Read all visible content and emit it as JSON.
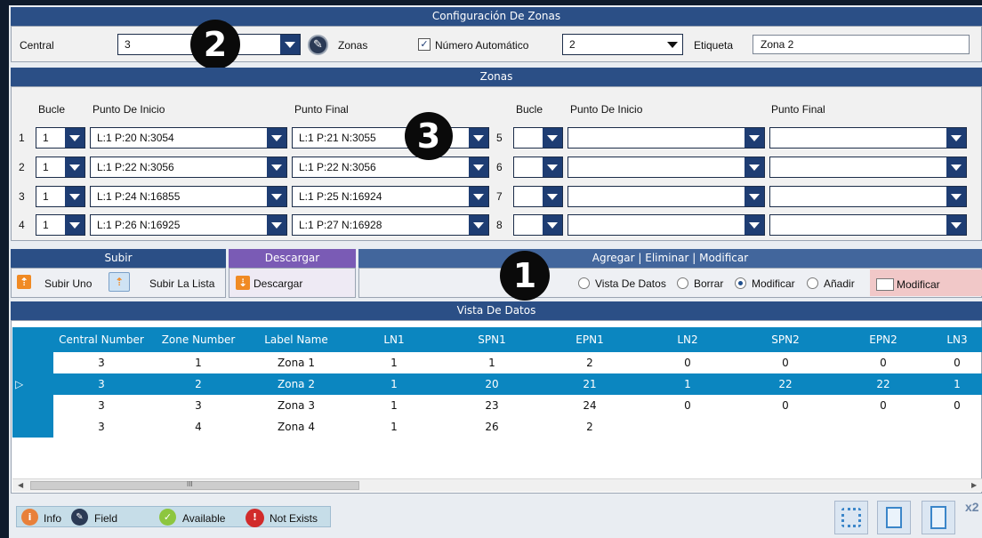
{
  "config": {
    "title": "Configuración De Zonas",
    "central_label": "Central",
    "central_value": "3",
    "zonas_label": "Zonas",
    "auto_number_label": "Número Automático",
    "auto_number_checked": true,
    "zone_select_value": "2",
    "etiqueta_label": "Etiqueta",
    "etiqueta_value": "Zona 2"
  },
  "zonas": {
    "title": "Zonas",
    "left_headers": {
      "bucle": "Bucle",
      "start": "Punto De Inicio",
      "end": "Punto Final"
    },
    "right_headers": {
      "bucle": "Bucle",
      "start": "Punto De Inicio",
      "end": "Punto Final"
    },
    "rows_left": [
      {
        "num": "1",
        "bucle": "1",
        "start": "L:1 P:20 N:3054",
        "end": "L:1 P:21 N:3055"
      },
      {
        "num": "2",
        "bucle": "1",
        "start": "L:1 P:22 N:3056",
        "end": "L:1 P:22 N:3056"
      },
      {
        "num": "3",
        "bucle": "1",
        "start": "L:1 P:24 N:16855",
        "end": "L:1 P:25 N:16924"
      },
      {
        "num": "4",
        "bucle": "1",
        "start": "L:1 P:26 N:16925",
        "end": "L:1 P:27 N:16928"
      }
    ],
    "rows_right": [
      {
        "num": "5",
        "bucle": "",
        "start": "",
        "end": ""
      },
      {
        "num": "6",
        "bucle": "",
        "start": "",
        "end": ""
      },
      {
        "num": "7",
        "bucle": "",
        "start": "",
        "end": ""
      },
      {
        "num": "8",
        "bucle": "",
        "start": "",
        "end": ""
      }
    ]
  },
  "badges": {
    "b1": "1",
    "b2": "2",
    "b3": "3"
  },
  "subir": {
    "title": "Subir",
    "subir_uno": "Subir Uno",
    "subir_lista": "Subir La Lista"
  },
  "descargar": {
    "title": "Descargar",
    "descargar": "Descargar"
  },
  "agregar": {
    "title": "Agregar | Eliminar | Modificar",
    "options": [
      "Vista De Datos",
      "Borrar",
      "Modificar",
      "Añadir"
    ],
    "selected": "Modificar",
    "action_button": "Modificar"
  },
  "vista": {
    "title": "Vista De Datos",
    "columns": [
      "Central Number",
      "Zone Number",
      "Label Name",
      "LN1",
      "SPN1",
      "EPN1",
      "LN2",
      "SPN2",
      "EPN2",
      "LN3"
    ],
    "rows": [
      [
        "3",
        "1",
        "Zona 1",
        "1",
        "1",
        "2",
        "0",
        "0",
        "0",
        "0"
      ],
      [
        "3",
        "2",
        "Zona 2",
        "1",
        "20",
        "21",
        "1",
        "22",
        "22",
        "1"
      ],
      [
        "3",
        "3",
        "Zona 3",
        "1",
        "23",
        "24",
        "0",
        "0",
        "0",
        "0"
      ],
      [
        "3",
        "4",
        "Zona 4",
        "1",
        "26",
        "2",
        "",
        "",
        "",
        ""
      ]
    ],
    "selected_row": 1,
    "scroll_grip": "III"
  },
  "legend": {
    "info": "Info",
    "field": "Field",
    "available": "Available",
    "not_exists": "Not Exists"
  },
  "corner_label": "x2"
}
